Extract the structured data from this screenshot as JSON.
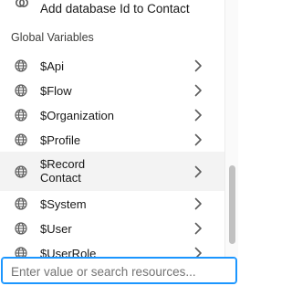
{
  "top_item": {
    "label": "Add database Id to Contact",
    "icon": "merge-icon"
  },
  "section": {
    "title": "Global Variables"
  },
  "items": [
    {
      "label": "$Api",
      "icon": "globe-icon"
    },
    {
      "label": "$Flow",
      "icon": "globe-icon"
    },
    {
      "label": "$Organization",
      "icon": "globe-icon"
    },
    {
      "label": "$Profile",
      "icon": "globe-icon"
    },
    {
      "label": "$Record",
      "sublabel": "Contact",
      "icon": "globe-icon",
      "highlighted": true
    },
    {
      "label": "$System",
      "icon": "globe-icon"
    },
    {
      "label": "$User",
      "icon": "globe-icon"
    },
    {
      "label": "$UserRole",
      "icon": "globe-icon"
    }
  ],
  "search": {
    "value": "",
    "placeholder": "Enter value or search resources..."
  },
  "colors": {
    "focus": "#1b96ff",
    "highlight_bg": "#f3f3f3",
    "icon": "#5c5c5c",
    "chevron": "#5c5c5c"
  }
}
